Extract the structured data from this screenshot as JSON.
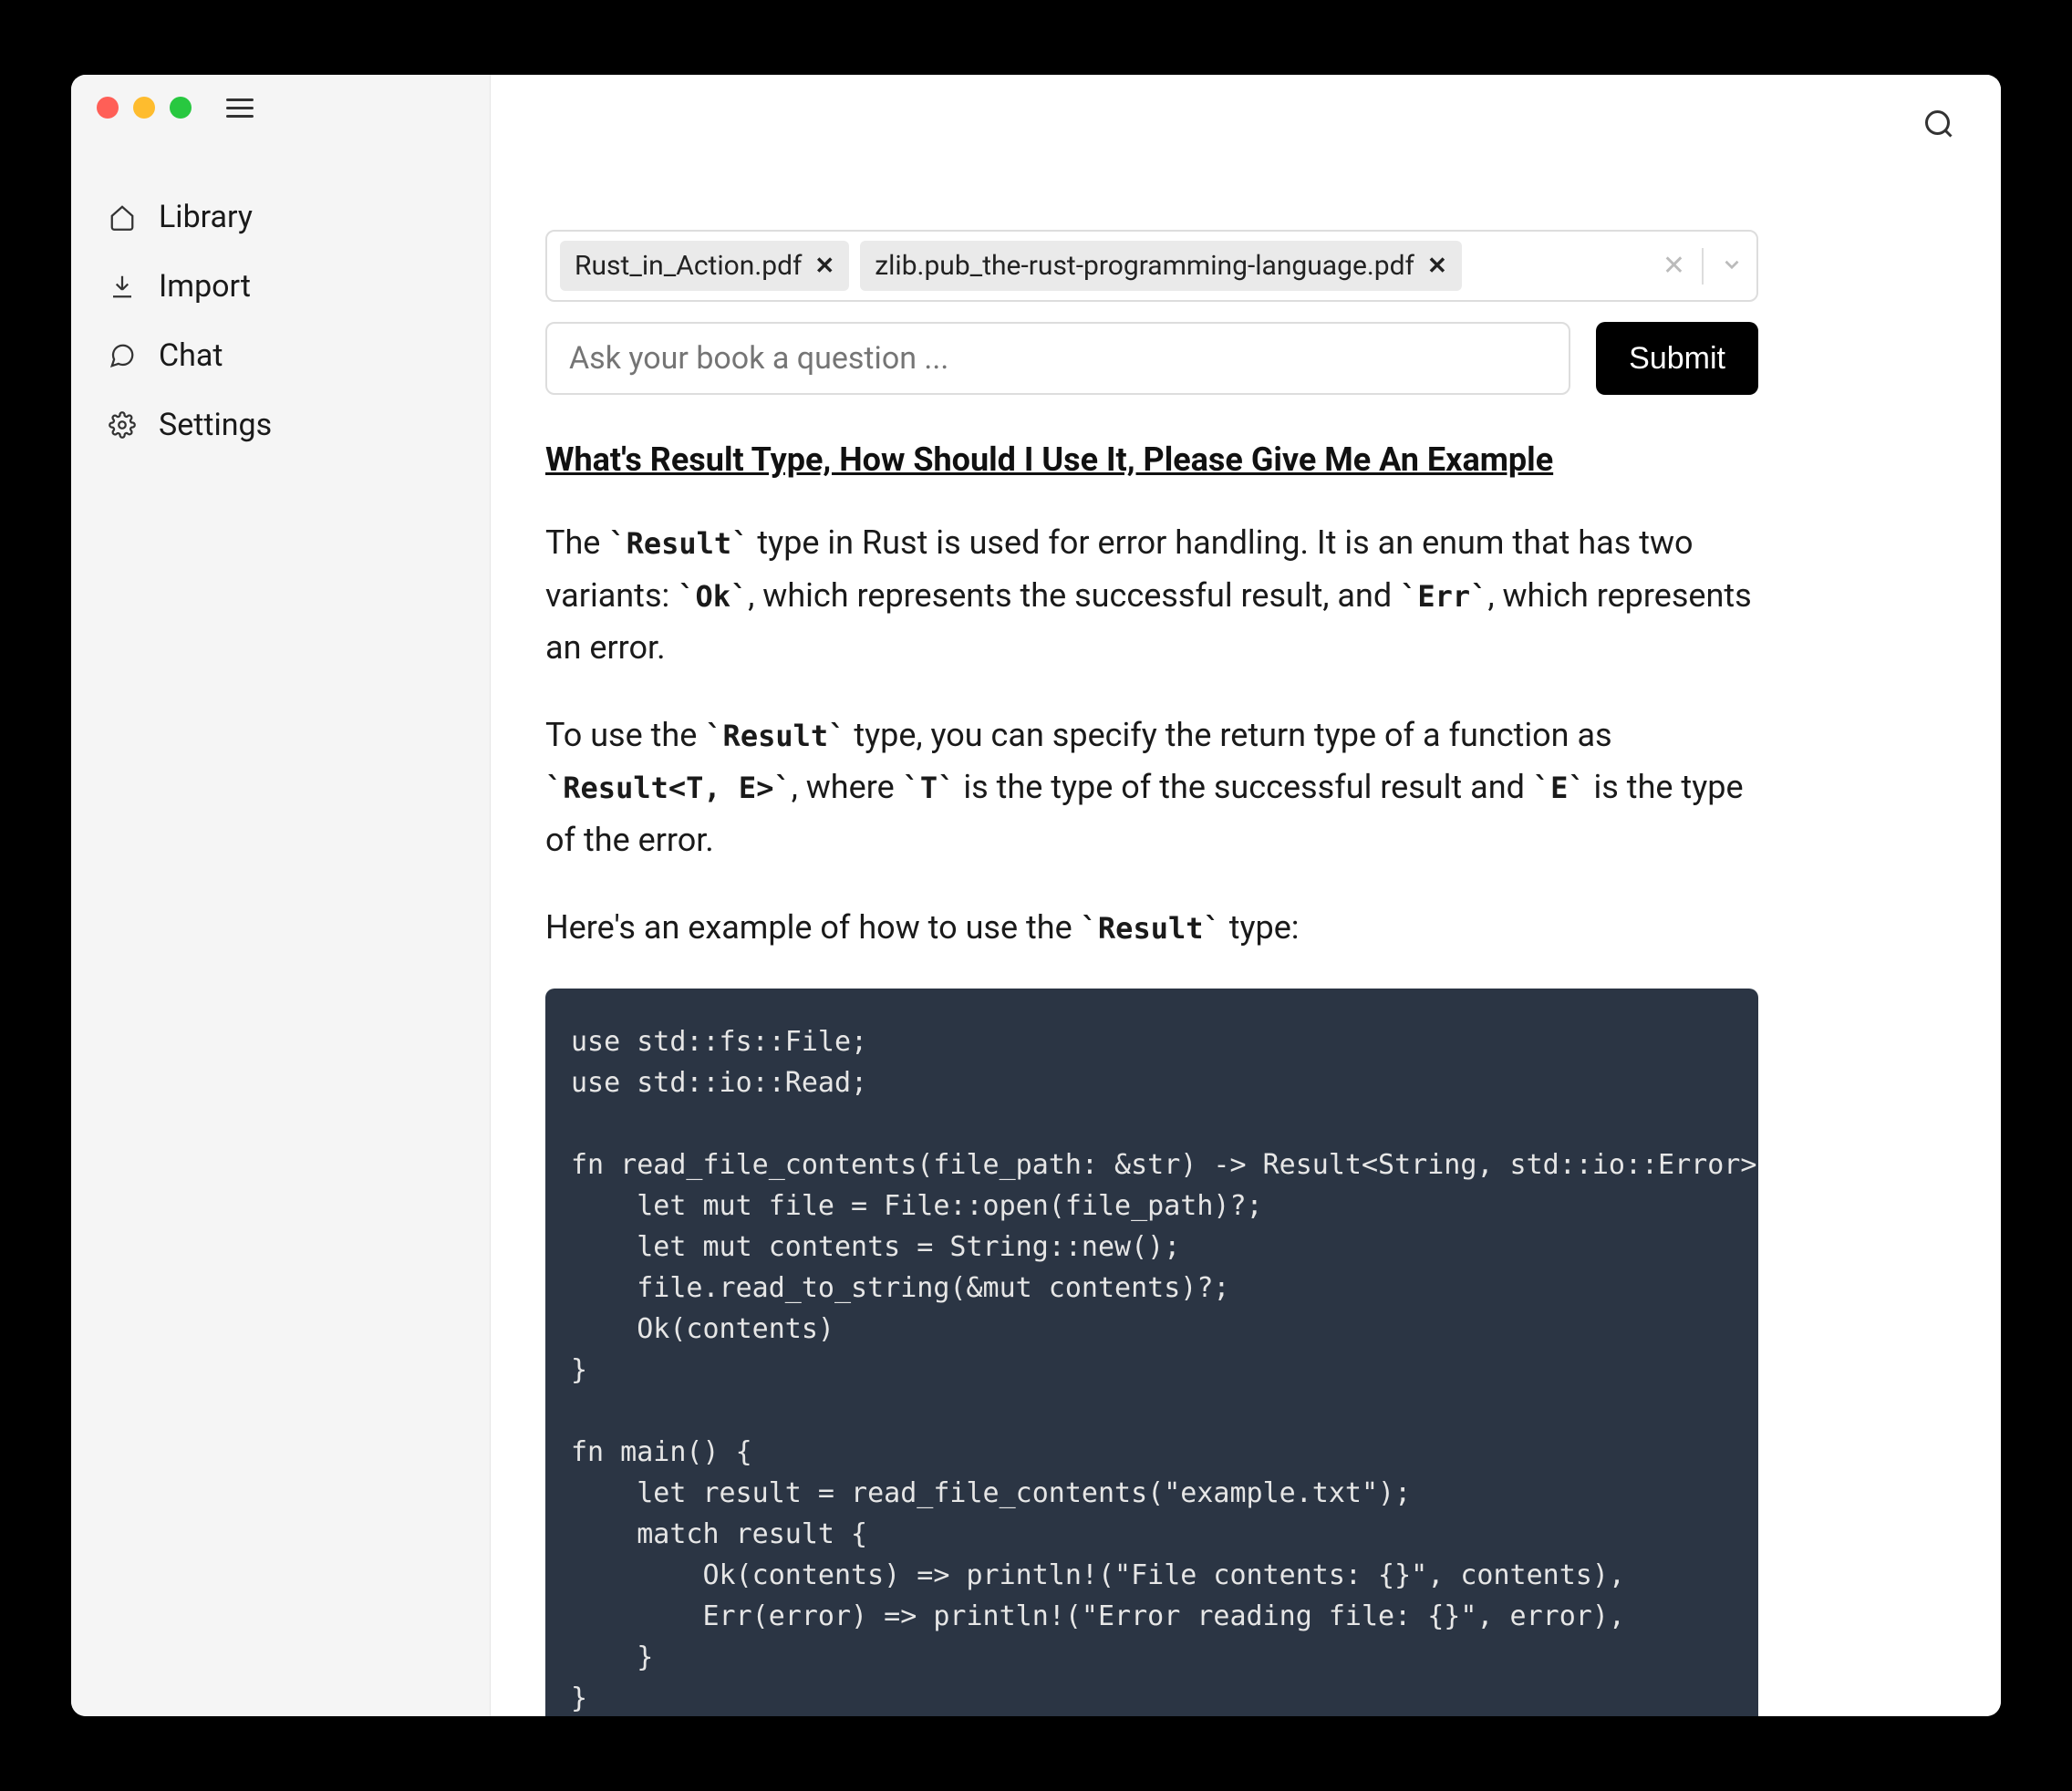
{
  "sidebar": {
    "items": [
      {
        "label": "Library",
        "icon": "home"
      },
      {
        "label": "Import",
        "icon": "download"
      },
      {
        "label": "Chat",
        "icon": "chat"
      },
      {
        "label": "Settings",
        "icon": "gear"
      }
    ]
  },
  "tags": {
    "items": [
      {
        "label": "Rust_in_Action.pdf"
      },
      {
        "label": "zlib.pub_the-rust-programming-language.pdf"
      }
    ]
  },
  "question": {
    "placeholder": "Ask your book a question ...",
    "submit_label": "Submit"
  },
  "answer": {
    "heading": "What's Result Type, How Should I Use It, Please Give Me An Example",
    "p1_a": "The ",
    "p1_c1": "`Result`",
    "p1_b": " type in Rust is used for error handling. It is an enum that has two variants: ",
    "p1_c2": "`Ok`",
    "p1_c": ", which represents the successful result, and ",
    "p1_c3": "`Err`",
    "p1_d": ", which represents an error.",
    "p2_a": "To use the ",
    "p2_c1": "`Result`",
    "p2_b": " type, you can specify the return type of a function as ",
    "p2_c2": "`Result<T, E>`",
    "p2_c": ", where ",
    "p2_c3": "`T`",
    "p2_d": " is the type of the successful result and ",
    "p2_c4": "`E`",
    "p2_e": " is the type of the error.",
    "p3_a": "Here's an example of how to use the ",
    "p3_c1": "`Result`",
    "p3_b": " type:",
    "code": "use std::fs::File;\nuse std::io::Read;\n\nfn read_file_contents(file_path: &str) -> Result<String, std::io::Error> {\n    let mut file = File::open(file_path)?;\n    let mut contents = String::new();\n    file.read_to_string(&mut contents)?;\n    Ok(contents)\n}\n\nfn main() {\n    let result = read_file_contents(\"example.txt\");\n    match result {\n        Ok(contents) => println!(\"File contents: {}\", contents),\n        Err(error) => println!(\"Error reading file: {}\", error),\n    }\n}"
  }
}
